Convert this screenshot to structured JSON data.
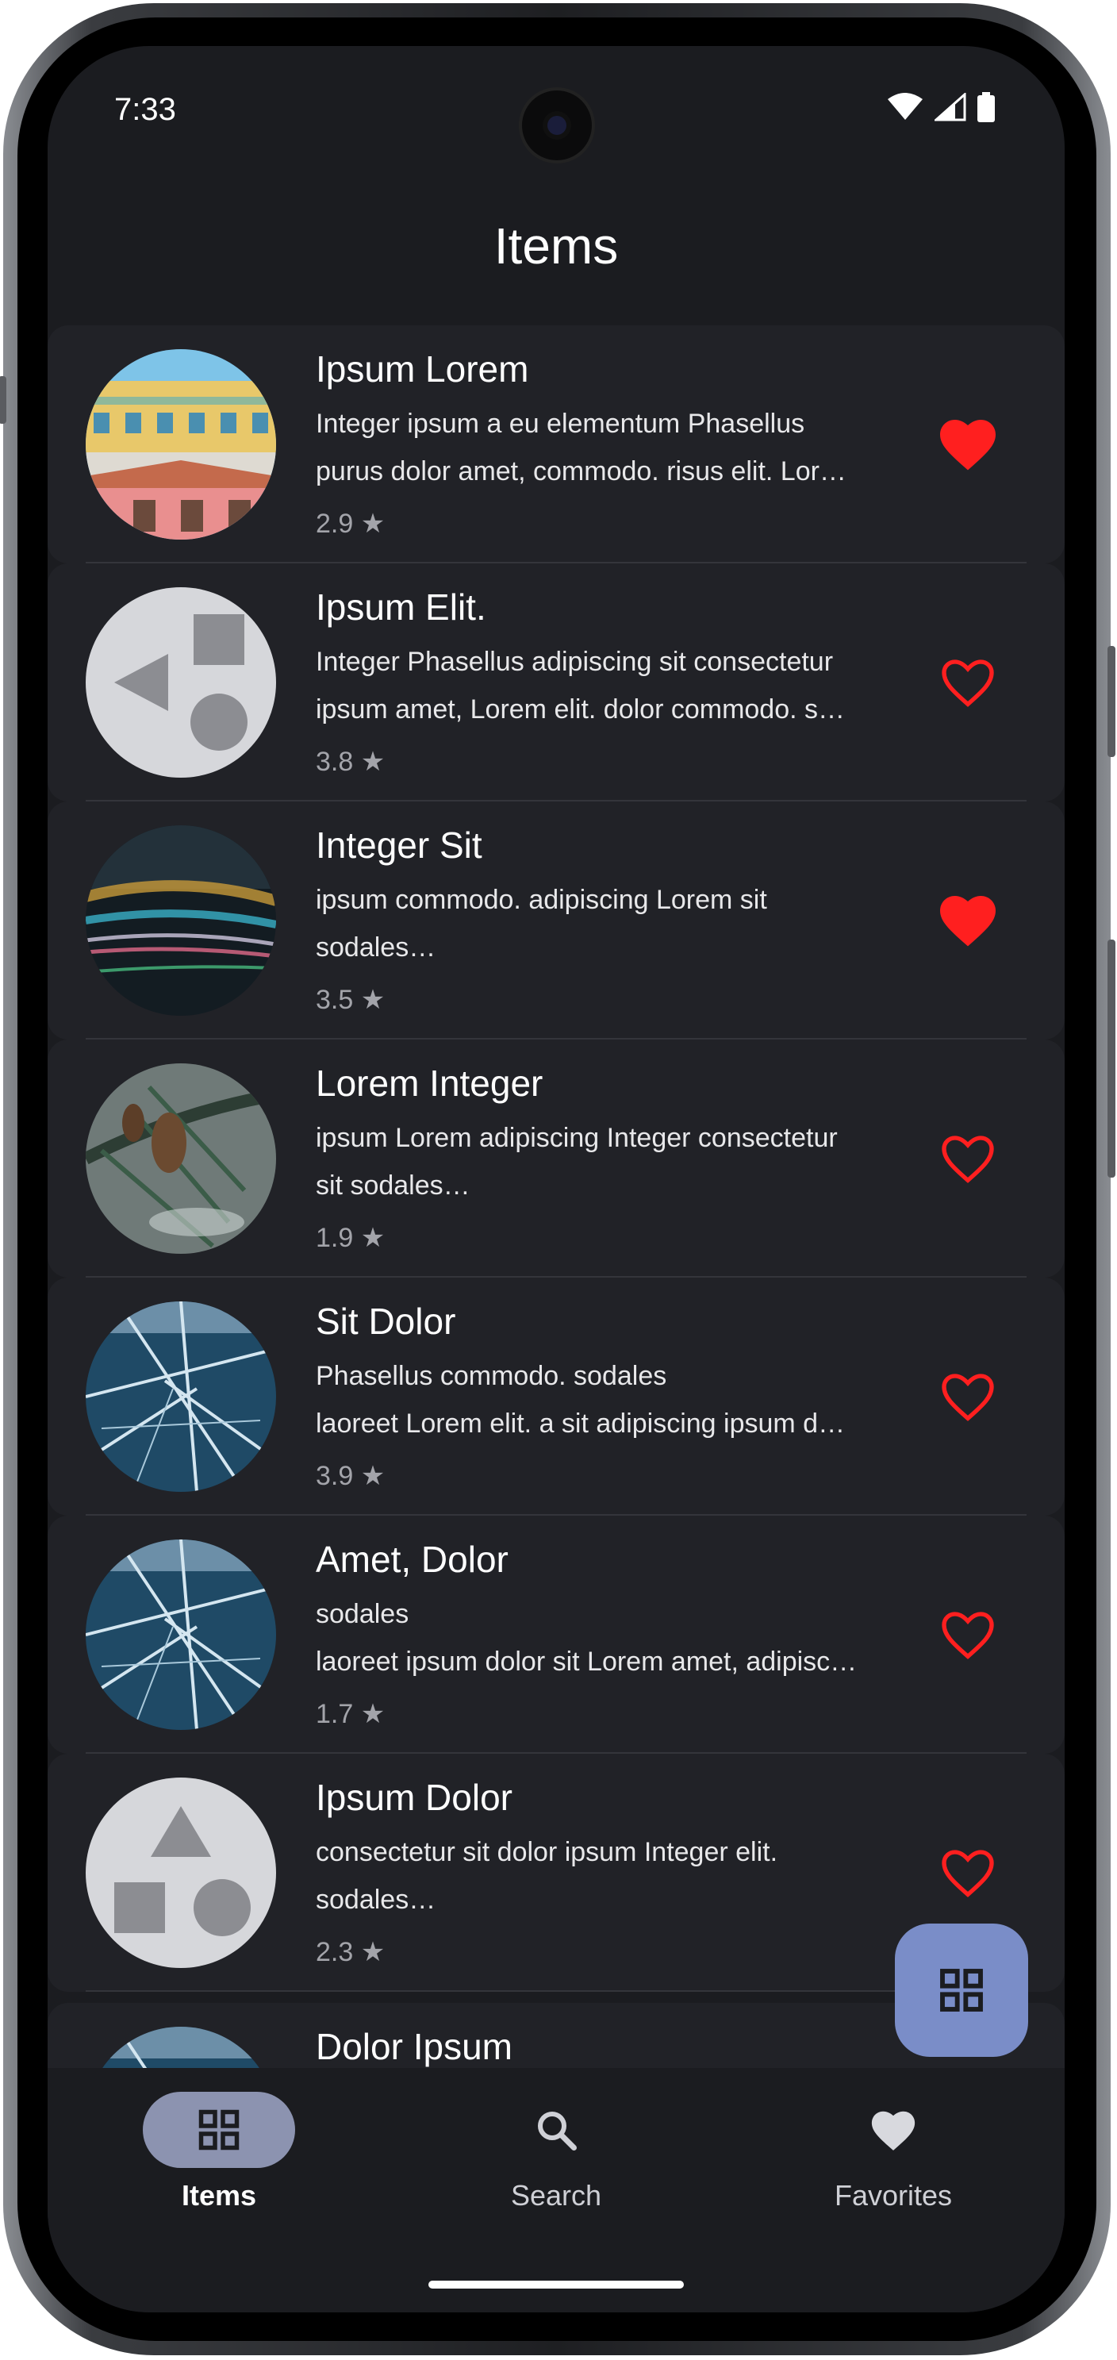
{
  "status_bar": {
    "time": "7:33"
  },
  "header": {
    "title": "Items"
  },
  "items": [
    {
      "name": "Ipsum Lorem",
      "line1": "Integer ipsum a eu elementum Phasellus",
      "line2": "purus dolor amet, commodo. risus elit. Lor…",
      "rating": "2.9 ★",
      "favorite": true
    },
    {
      "name": "Ipsum Elit.",
      "line1": "Integer Phasellus adipiscing sit consectetur",
      "line2": "ipsum amet, Lorem elit. dolor commodo. s…",
      "rating": "3.8 ★",
      "favorite": false
    },
    {
      "name": "Integer Sit",
      "line1": "ipsum commodo. adipiscing Lorem sit",
      "line2": "sodales…",
      "rating": "3.5 ★",
      "favorite": true
    },
    {
      "name": "Lorem Integer",
      "line1": "ipsum Lorem adipiscing Integer consectetur",
      "line2": "sit sodales…",
      "rating": "1.9 ★",
      "favorite": false
    },
    {
      "name": "Sit Dolor",
      "line1": "Phasellus commodo. sodales",
      "line2": "laoreet Lorem elit. a sit adipiscing ipsum d…",
      "rating": "3.9 ★",
      "favorite": false
    },
    {
      "name": "Amet, Dolor",
      "line1": "sodales",
      "line2": "laoreet ipsum dolor sit Lorem amet, adipisc…",
      "rating": "1.7 ★",
      "favorite": false
    },
    {
      "name": "Ipsum Dolor",
      "line1": "consectetur sit dolor ipsum Integer elit.",
      "line2": "sodales…",
      "rating": "2.3 ★",
      "favorite": false
    },
    {
      "name": "Dolor Ipsum"
    }
  ],
  "nav": {
    "items_label": "Items",
    "search_label": "Search",
    "favorites_label": "Favorites"
  },
  "colors": {
    "heart": "#ff1f1f",
    "fab": "#7a8dc8",
    "nav_active": "#8c93b0"
  }
}
